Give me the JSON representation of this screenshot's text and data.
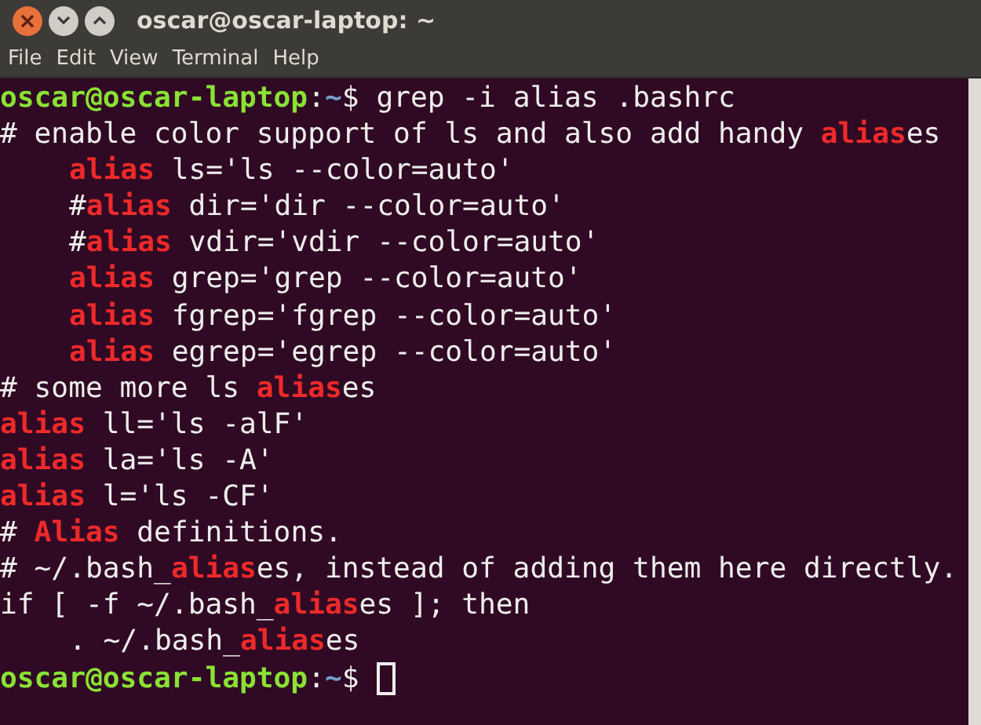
{
  "window": {
    "title": "oscar@oscar-laptop: ~"
  },
  "menu": [
    "File",
    "Edit",
    "View",
    "Terminal",
    "Help"
  ],
  "terminal": {
    "lines": [
      {
        "indented": false,
        "segments": [
          {
            "kind": "user",
            "text": "oscar@oscar-laptop"
          },
          {
            "kind": "plain",
            "text": ":"
          },
          {
            "kind": "path",
            "text": "~"
          },
          {
            "kind": "plain",
            "text": "$ grep -i alias .bashrc"
          }
        ]
      },
      {
        "indented": false,
        "segments": [
          {
            "kind": "plain",
            "text": "# enable color support of ls and also add handy "
          },
          {
            "kind": "match",
            "text": "alias"
          },
          {
            "kind": "plain",
            "text": "es"
          }
        ]
      },
      {
        "indented": true,
        "segments": [
          {
            "kind": "match",
            "text": "alias"
          },
          {
            "kind": "plain",
            "text": " ls='ls --color=auto'"
          }
        ]
      },
      {
        "indented": true,
        "segments": [
          {
            "kind": "plain",
            "text": "#"
          },
          {
            "kind": "match",
            "text": "alias"
          },
          {
            "kind": "plain",
            "text": " dir='dir --color=auto'"
          }
        ]
      },
      {
        "indented": true,
        "segments": [
          {
            "kind": "plain",
            "text": "#"
          },
          {
            "kind": "match",
            "text": "alias"
          },
          {
            "kind": "plain",
            "text": " vdir='vdir --color=auto'"
          }
        ]
      },
      {
        "indented": true,
        "segments": [
          {
            "kind": "match",
            "text": "alias"
          },
          {
            "kind": "plain",
            "text": " grep='grep --color=auto'"
          }
        ]
      },
      {
        "indented": true,
        "segments": [
          {
            "kind": "match",
            "text": "alias"
          },
          {
            "kind": "plain",
            "text": " fgrep='fgrep --color=auto'"
          }
        ]
      },
      {
        "indented": true,
        "segments": [
          {
            "kind": "match",
            "text": "alias"
          },
          {
            "kind": "plain",
            "text": " egrep='egrep --color=auto'"
          }
        ]
      },
      {
        "indented": false,
        "segments": [
          {
            "kind": "plain",
            "text": "# some more ls "
          },
          {
            "kind": "match",
            "text": "alias"
          },
          {
            "kind": "plain",
            "text": "es"
          }
        ]
      },
      {
        "indented": false,
        "segments": [
          {
            "kind": "match",
            "text": "alias"
          },
          {
            "kind": "plain",
            "text": " ll='ls -alF'"
          }
        ]
      },
      {
        "indented": false,
        "segments": [
          {
            "kind": "match",
            "text": "alias"
          },
          {
            "kind": "plain",
            "text": " la='ls -A'"
          }
        ]
      },
      {
        "indented": false,
        "segments": [
          {
            "kind": "match",
            "text": "alias"
          },
          {
            "kind": "plain",
            "text": " l='ls -CF'"
          }
        ]
      },
      {
        "indented": false,
        "segments": [
          {
            "kind": "plain",
            "text": "# "
          },
          {
            "kind": "match",
            "text": "Alias"
          },
          {
            "kind": "plain",
            "text": " definitions."
          }
        ]
      },
      {
        "indented": false,
        "segments": [
          {
            "kind": "plain",
            "text": "# ~/.bash_"
          },
          {
            "kind": "match",
            "text": "alias"
          },
          {
            "kind": "plain",
            "text": "es, instead of adding them here directly."
          }
        ]
      },
      {
        "indented": false,
        "segments": [
          {
            "kind": "plain",
            "text": "if [ -f ~/.bash_"
          },
          {
            "kind": "match",
            "text": "alias"
          },
          {
            "kind": "plain",
            "text": "es ]; then"
          }
        ]
      },
      {
        "indented": true,
        "segments": [
          {
            "kind": "plain",
            "text": ". ~/.bash_"
          },
          {
            "kind": "match",
            "text": "alias"
          },
          {
            "kind": "plain",
            "text": "es"
          }
        ]
      },
      {
        "indented": false,
        "segments": [
          {
            "kind": "user",
            "text": "oscar@oscar-laptop"
          },
          {
            "kind": "plain",
            "text": ":"
          },
          {
            "kind": "path",
            "text": "~"
          },
          {
            "kind": "plain",
            "text": "$"
          }
        ]
      }
    ],
    "cursor": true
  }
}
